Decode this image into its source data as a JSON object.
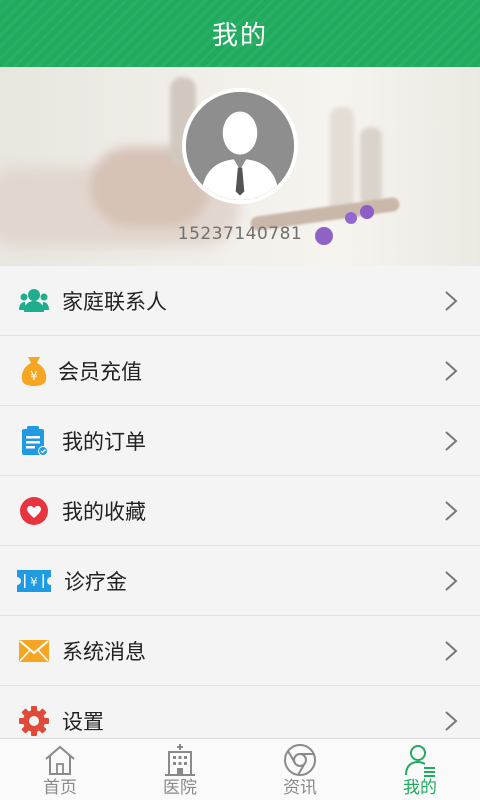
{
  "header": {
    "title": "我的"
  },
  "profile": {
    "phone": "15237140781"
  },
  "menu": [
    {
      "label": "家庭联系人",
      "icon": "family-contacts-icon"
    },
    {
      "label": "会员充值",
      "icon": "money-bag-icon"
    },
    {
      "label": "我的订单",
      "icon": "order-clipboard-icon"
    },
    {
      "label": "我的收藏",
      "icon": "heart-icon"
    },
    {
      "label": "诊疗金",
      "icon": "ticket-yen-icon"
    },
    {
      "label": "系统消息",
      "icon": "envelope-icon"
    },
    {
      "label": "设置",
      "icon": "gear-icon"
    }
  ],
  "nav": [
    {
      "label": "首页",
      "icon": "home-icon"
    },
    {
      "label": "医院",
      "icon": "hospital-icon"
    },
    {
      "label": "资讯",
      "icon": "news-icon"
    },
    {
      "label": "我的",
      "icon": "user-profile-icon",
      "active": true
    }
  ],
  "colors": {
    "brand_green": "#20ab5f",
    "heart_red": "#e8343f",
    "gear_red": "#e04a38",
    "icon_blue": "#1e9be3",
    "icon_orange": "#f5a623",
    "icon_teal": "#1fae8d"
  }
}
